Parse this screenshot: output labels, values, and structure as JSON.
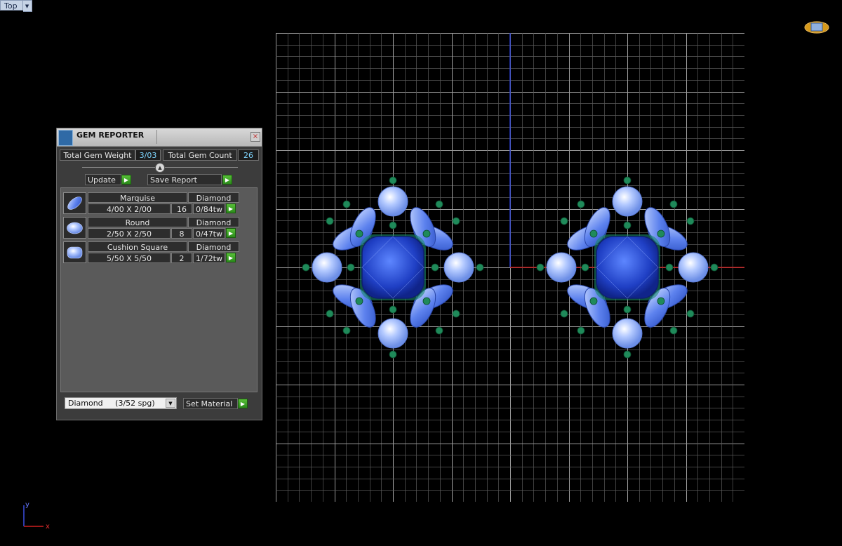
{
  "viewport": {
    "view_name": "Top"
  },
  "colors": {
    "grid": "#6f6f6f",
    "axis_y": "#2a3fd0",
    "axis_x": "#c01818",
    "accent_value": "#7fd6ff",
    "go_button": "#3aa824"
  },
  "gem_reporter": {
    "title": "GEM REPORTER",
    "total_weight_label": "Total Gem Weight",
    "total_weight_value": "3/03",
    "total_count_label": "Total Gem Count",
    "total_count_value": "26",
    "update_label": "Update",
    "save_report_label": "Save Report",
    "gems": [
      {
        "shape": "Marquise",
        "material": "Diamond",
        "size": "4/00 X 2/00",
        "count": "16",
        "weight": "0/84tw",
        "icon": "marquise-gem-icon"
      },
      {
        "shape": "Round",
        "material": "Diamond",
        "size": "2/50 X 2/50",
        "count": "8",
        "weight": "0/47tw",
        "icon": "round-gem-icon"
      },
      {
        "shape": "Cushion Square",
        "material": "Diamond",
        "size": "5/50 X 5/50",
        "count": "2",
        "weight": "1/72tw",
        "icon": "cushion-gem-icon"
      }
    ],
    "material_select": "Diamond     (3/52 spg)",
    "set_material_label": "Set Material"
  },
  "axis_indicator": {
    "x": "x",
    "y": "y"
  }
}
